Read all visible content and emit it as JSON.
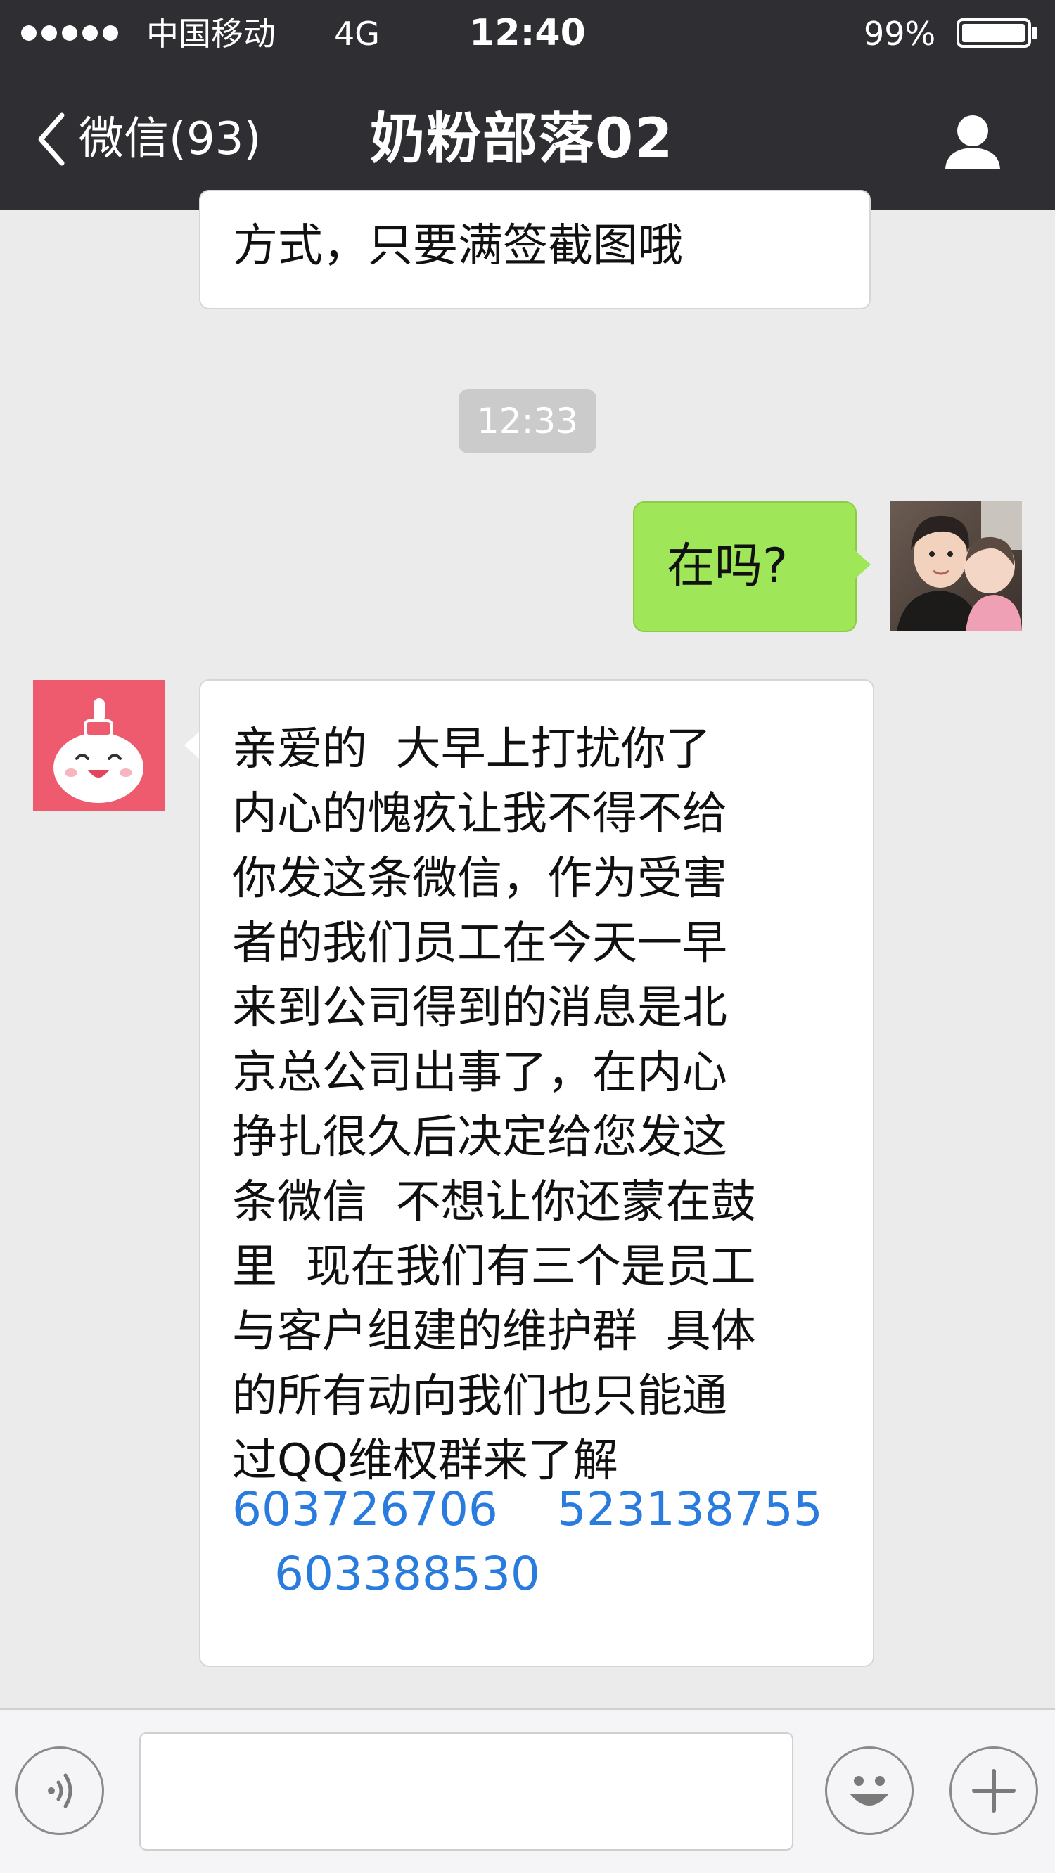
{
  "status_bar": {
    "carrier": "中国移动",
    "network": "4G",
    "time": "12:40",
    "battery": "99%",
    "battery_level": 0.99
  },
  "nav": {
    "back_label": "微信(93)",
    "title": "奶粉部落02",
    "profile_icon": "person-icon"
  },
  "messages": {
    "top_partial": "方式，只要满签截图哦",
    "timestamp": "12:33",
    "mine": "在吗?",
    "other_lines": [
      "亲爱的  大早上打扰你了",
      "内心的愧疚让我不得不给",
      "你发这条微信，作为受害",
      "者的我们员工在今天一早",
      "来到公司得到的消息是北",
      "京总公司出事了，在内心",
      "挣扎很久后决定给您发这",
      "条微信  不想让你还蒙在鼓",
      "里  现在我们有三个是员工",
      "与客户组建的维护群  具体",
      "的所有动向我们也只能通",
      "过QQ维权群来了解"
    ],
    "links": [
      "603726706",
      "523138755",
      "603388530"
    ]
  },
  "input_bar": {
    "voice_icon": "voice-icon",
    "emoji_icon": "emoji-icon",
    "plus_icon": "plus-icon"
  },
  "colors": {
    "nav_bg": "#2e2e33",
    "chat_bg": "#ebebeb",
    "my_bubble": "#9fe658",
    "link": "#2a7bde"
  }
}
